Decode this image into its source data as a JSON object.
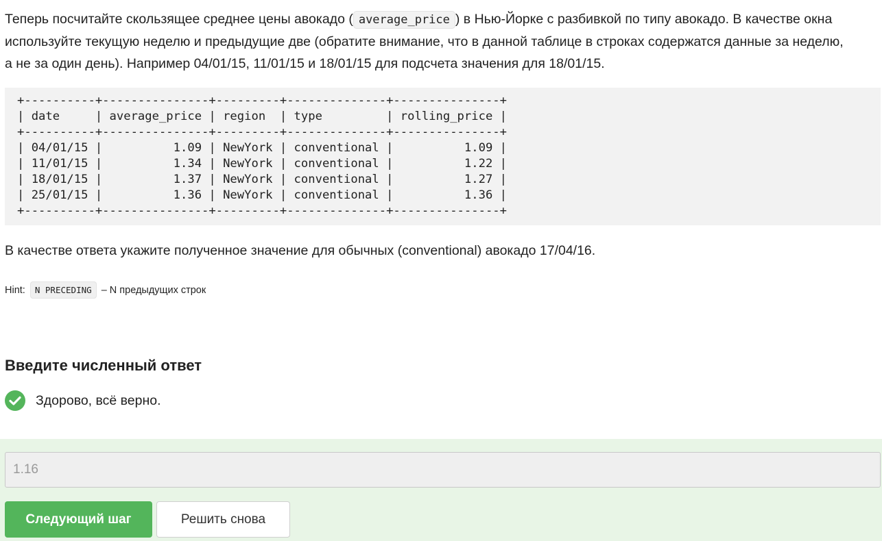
{
  "task": {
    "p1_before": "Теперь посчитайте скользящее среднее цены авокадо (",
    "p1_code": "average_price",
    "p1_line1_after": ") в Нью-Йорке с разбивкой по типу авокадо. В качестве окна",
    "p1_line2": "используйте текущую неделю и предыдущие две (обратите внимание, что в данной таблице в строках содержатся данные за неделю,",
    "p1_line3": "а не за один день). Например 04/01/15, 11/01/15 и 18/01/15 для подсчета значения для 18/01/15."
  },
  "example_table": {
    "text": "+----------+---------------+---------+--------------+---------------+\n| date     | average_price | region  | type         | rolling_price |\n+----------+---------------+---------+--------------+---------------+\n| 04/01/15 |          1.09 | NewYork | conventional |          1.09 |\n| 11/01/15 |          1.34 | NewYork | conventional |          1.22 |\n| 18/01/15 |          1.37 | NewYork | conventional |          1.27 |\n| 25/01/15 |          1.36 | NewYork | conventional |          1.36 |\n+----------+---------------+---------+--------------+---------------+"
  },
  "answer_instruction": "В качестве ответа укажите полученное значение для обычных (conventional) авокадо 17/04/16.",
  "hint": {
    "label": "Hint:",
    "code": "N PRECEDING",
    "text": "– N предыдущих строк"
  },
  "answer_section": {
    "title": "Введите численный ответ",
    "status_text": "Здорово, всё верно.",
    "input_value": "1.16",
    "next_button": "Следующий шаг",
    "retry_button": "Решить снова"
  },
  "colors": {
    "success_green": "#54b55b",
    "panel_bg": "#e8f5e6",
    "code_bg": "#f2f2f2"
  },
  "icons": {
    "status": "check-circle-icon"
  }
}
